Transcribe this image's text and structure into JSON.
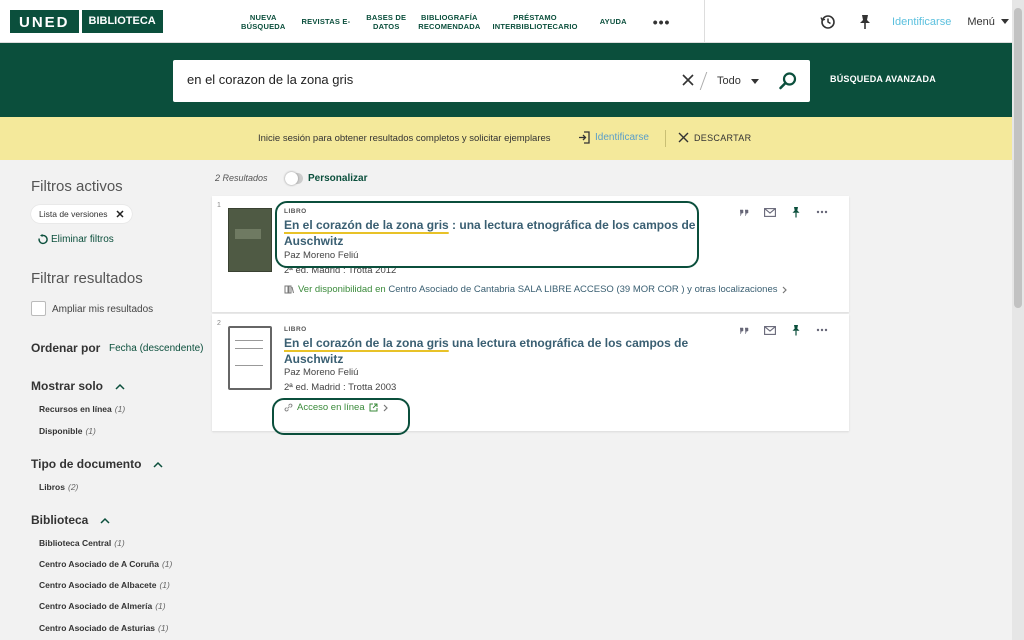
{
  "header": {
    "logo_uned": "UNED",
    "logo_biblioteca": "BIBLIOTECA",
    "nav": [
      {
        "line1": "NUEVA",
        "line2": "BÚSQUEDA"
      },
      {
        "line1": "REVISTAS E-",
        "line2": ""
      },
      {
        "line1": "BASES DE",
        "line2": "DATOS"
      },
      {
        "line1": "BIBLIOGRAFÍA",
        "line2": "RECOMENDADA"
      },
      {
        "line1": "PRÉSTAMO",
        "line2": "INTERBIBLIOTECARIO"
      },
      {
        "line1": "AYUDA",
        "line2": ""
      }
    ],
    "more": "•••",
    "signin": "Identificarse",
    "menu": "Menú"
  },
  "search": {
    "query": "en el corazon de la zona gris",
    "scope": "Todo",
    "advanced": "BÚSQUEDA AVANZADA"
  },
  "notice": {
    "text": "Inicie sesión para obtener resultados completos y solicitar ejemplares",
    "signin": "Identificarse",
    "dismiss": "DESCARTAR"
  },
  "sidebar": {
    "active_filters_title": "Filtros activos",
    "active_chip": "Lista de versiones",
    "clear_filters": "Eliminar filtros",
    "filter_title": "Filtrar resultados",
    "expand_label": "Ampliar mis resultados",
    "sort_label": "Ordenar por",
    "sort_value": "Fecha (descendente)",
    "facets": [
      {
        "title": "Mostrar solo",
        "items": [
          {
            "label": "Recursos en línea",
            "count": "(1)"
          },
          {
            "label": "Disponible",
            "count": "(1)"
          }
        ]
      },
      {
        "title": "Tipo de documento",
        "items": [
          {
            "label": "Libros",
            "count": "(2)"
          }
        ]
      },
      {
        "title": "Biblioteca",
        "items": [
          {
            "label": "Biblioteca Central",
            "count": "(1)"
          },
          {
            "label": "Centro Asociado de A Coruña",
            "count": "(1)"
          },
          {
            "label": "Centro Asociado de Albacete",
            "count": "(1)"
          },
          {
            "label": "Centro Asociado de Almería",
            "count": "(1)"
          },
          {
            "label": "Centro Asociado de Asturias",
            "count": "(1)"
          }
        ]
      }
    ]
  },
  "results": {
    "count": "2 Resultados",
    "personalize": "Personalizar",
    "items": [
      {
        "num": "1",
        "type": "LIBRO",
        "title_hl": "En el corazón de la zona gris",
        "title_rest": " : una lectura etnográfica de los campos de Auschwitz",
        "author": "Paz Moreno Feliú",
        "edition": "2ª ed. Madrid : Trotta 2012",
        "avail_label": "Ver disponibilidad en",
        "avail_location": "Centro Asociado de Cantabria  SALA LIBRE ACCESO (39 MOR COR ) y otras localizaciones"
      },
      {
        "num": "2",
        "type": "LIBRO",
        "title_hl": "En el corazón de la zona gris",
        "title_rest": " una lectura etnográfica de los campos de Auschwitz",
        "author": "Paz Moreno Feliú",
        "edition": "2ª ed. Madrid : Trotta 2003",
        "online": "Acceso en línea"
      }
    ]
  },
  "colors": {
    "brand": "#0b4f3c",
    "notice": "#f4e99b",
    "link": "#5bc0de",
    "highlight": "#e8c228"
  }
}
